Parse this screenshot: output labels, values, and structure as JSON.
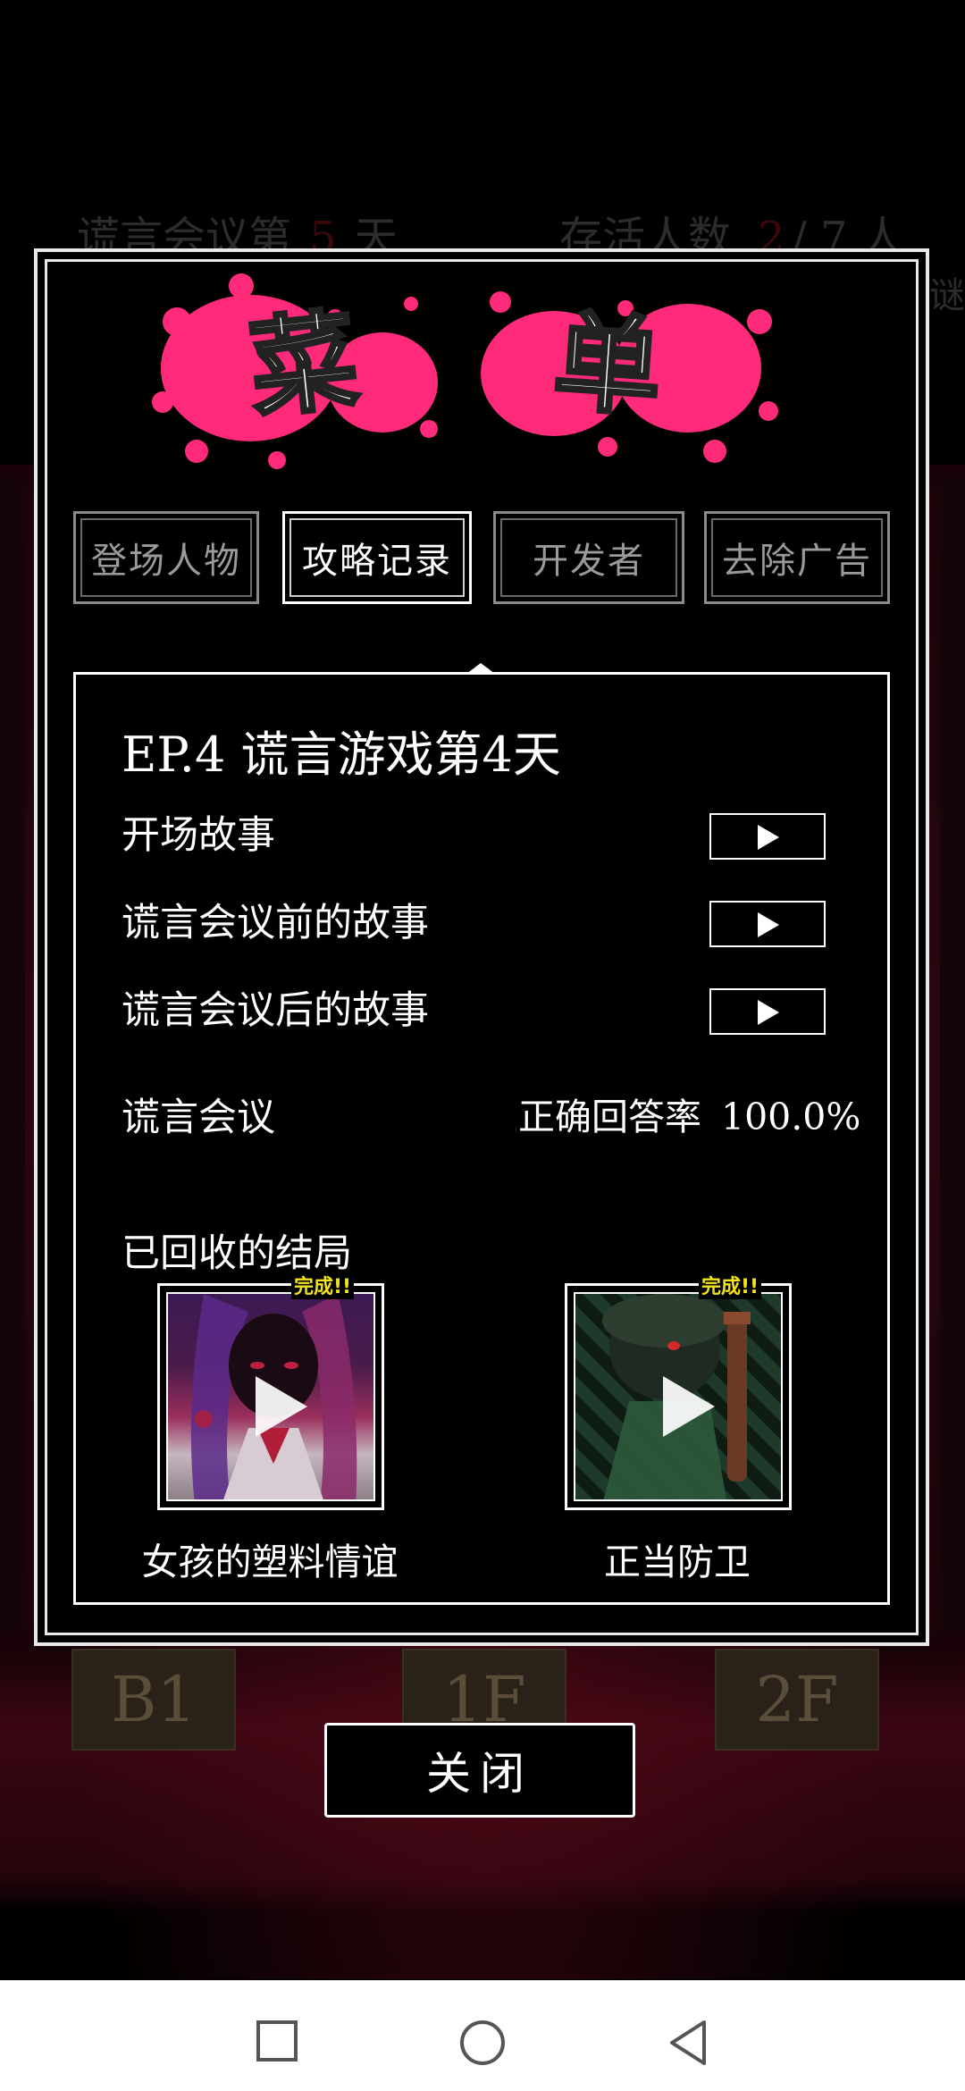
{
  "hud": {
    "day_prefix": "谎言会议第",
    "day_number": "5",
    "day_suffix": "天",
    "survivors_prefix": "存活人数",
    "survivors_alive": "2",
    "survivors_total": "/ 7 人",
    "edge_text": "谜"
  },
  "floors": [
    "B1",
    "1F",
    "2F"
  ],
  "menu": {
    "title_chars": [
      "菜",
      "单"
    ],
    "splash_color": "#ff2a7a",
    "tabs": [
      {
        "label": "登场人物",
        "active": false
      },
      {
        "label": "攻略记录",
        "active": true
      },
      {
        "label": "开发者",
        "active": false
      },
      {
        "label": "去除广告",
        "active": false
      }
    ]
  },
  "record": {
    "episode_title": "EP.4  谎言游戏第4天",
    "stories": [
      {
        "label": "开场故事"
      },
      {
        "label": "谎言会议前的故事"
      },
      {
        "label": "谎言会议后的故事"
      }
    ],
    "meeting_label": "谎言会议",
    "accuracy_label": "正确回答率",
    "accuracy_value": "100.0%",
    "endings_heading": "已回收的结局",
    "endings": [
      {
        "title": "女孩的塑料情谊",
        "badge": "完成!!"
      },
      {
        "title": "正当防卫",
        "badge": "完成!!"
      }
    ]
  },
  "close_label": "关闭",
  "nav": {
    "icons": [
      "square-recents-icon",
      "circle-home-icon",
      "triangle-back-icon"
    ]
  }
}
